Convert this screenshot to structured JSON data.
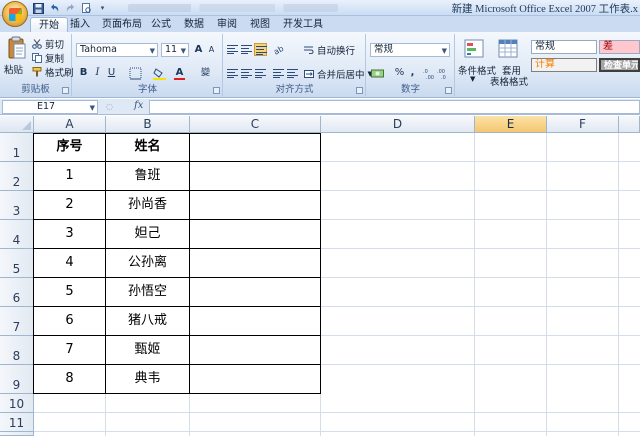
{
  "window": {
    "title": "新建 Microsoft Office Excel 2007 工作表.x"
  },
  "quick_access": [
    "save-icon",
    "undo-icon",
    "redo-icon",
    "print-preview-icon"
  ],
  "tabs": [
    "开始",
    "插入",
    "页面布局",
    "公式",
    "数据",
    "审阅",
    "视图",
    "开发工具"
  ],
  "active_tab": "开始",
  "ribbon": {
    "clipboard": {
      "paste": "粘贴",
      "cut": "剪切",
      "copy": "复制",
      "format_painter": "格式刷",
      "label": "剪贴板"
    },
    "font": {
      "name": "Tahoma",
      "size": "11",
      "grow": "A",
      "shrink": "A",
      "bold": "B",
      "italic": "I",
      "underline": "U",
      "color_letter": "A",
      "phonetic": "變",
      "label": "字体"
    },
    "alignment": {
      "wrap_text": "自动换行",
      "merge_center": "合并后居中",
      "label": "对齐方式"
    },
    "number": {
      "format": "常规",
      "percent": "%",
      "comma": ",",
      "label": "数字"
    },
    "styles": {
      "conditional": "条件格式",
      "table_format_1": "套用",
      "table_format_2": "表格格式",
      "normal": "常规",
      "bad": "差",
      "calculation": "计算",
      "check_cell": "检查单元"
    }
  },
  "formula_bar": {
    "name_box": "E17",
    "fx": "fx",
    "value": ""
  },
  "grid": {
    "columns": [
      "A",
      "B",
      "C",
      "D",
      "E",
      "F"
    ],
    "selected_column": "E",
    "rows": [
      "1",
      "2",
      "3",
      "4",
      "5",
      "6",
      "7",
      "8",
      "9",
      "10",
      "11"
    ],
    "header": {
      "a": "序号",
      "b": "姓名"
    },
    "data": [
      {
        "a": "1",
        "b": "鲁班"
      },
      {
        "a": "2",
        "b": "孙尚香"
      },
      {
        "a": "3",
        "b": "妲己"
      },
      {
        "a": "4",
        "b": "公孙离"
      },
      {
        "a": "5",
        "b": "孙悟空"
      },
      {
        "a": "6",
        "b": "猪八戒"
      },
      {
        "a": "7",
        "b": "甄姬"
      },
      {
        "a": "8",
        "b": "典韦"
      }
    ]
  }
}
